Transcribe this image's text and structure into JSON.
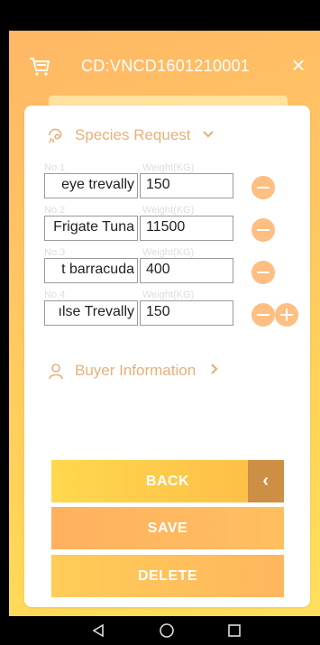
{
  "header": {
    "title": "CD:VNCD1601210001",
    "close_glyph": "×",
    "cart_icon": "cart-icon",
    "close_icon": "close-icon"
  },
  "species_section": {
    "title": "Species Request",
    "icon": "species-icon",
    "chevron_icon": "chevron-down-icon"
  },
  "species_rows": [
    {
      "no": "No.1",
      "weight_label": "Weight(KG)",
      "species": "eye trevally",
      "weight": "150"
    },
    {
      "no": "No.2",
      "weight_label": "Weight(KG)",
      "species": "Frigate Tuna",
      "weight": "11500"
    },
    {
      "no": "No.3",
      "weight_label": "Weight(KG)",
      "species": "t barracuda",
      "weight": "400"
    },
    {
      "no": "No.4",
      "weight_label": "Weight(KG)",
      "species": "ılse Trevally",
      "weight": "150"
    }
  ],
  "buyer_section": {
    "title": "Buyer Information",
    "icon": "person-icon",
    "chevron_icon": "chevron-right-icon"
  },
  "buttons": {
    "back": "BACK",
    "back_arrow": "‹",
    "save": "SAVE",
    "delete": "DELETE"
  },
  "colors": {
    "accent": "#e7b07a",
    "circle_button": "#ffbe82",
    "back_arrow_box": "#cc8f44"
  },
  "nav_bar": {
    "icons": [
      "back-triangle-icon",
      "home-circle-icon",
      "recents-square-icon"
    ]
  }
}
